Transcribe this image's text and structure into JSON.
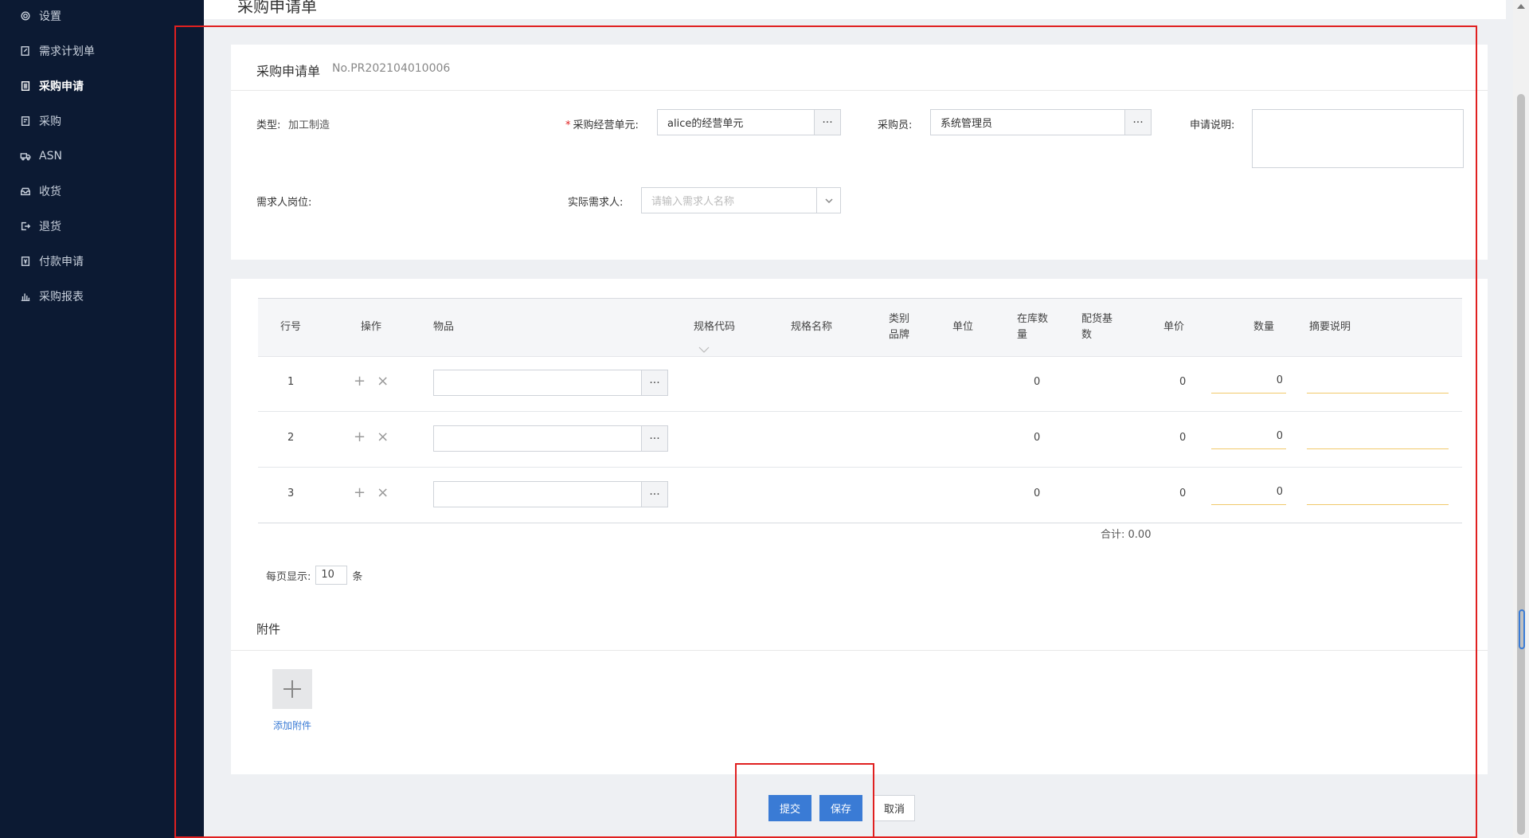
{
  "sidebar": {
    "items": [
      {
        "label": "设置",
        "icon": "gear-icon"
      },
      {
        "label": "需求计划单",
        "icon": "document-edit-icon"
      },
      {
        "label": "采购申请",
        "icon": "document-list-icon"
      },
      {
        "label": "采购",
        "icon": "document-icon"
      },
      {
        "label": "ASN",
        "icon": "truck-icon"
      },
      {
        "label": "收货",
        "icon": "inbox-icon"
      },
      {
        "label": "退货",
        "icon": "exit-icon"
      },
      {
        "label": "付款申请",
        "icon": "payment-icon"
      },
      {
        "label": "采购报表",
        "icon": "bar-chart-icon"
      }
    ],
    "active_index": 2
  },
  "page": {
    "title": "采购申请单"
  },
  "form": {
    "header_title": "采购申请单",
    "number": "No.PR202104010006",
    "type_label": "类型:",
    "type_value": "加工制造",
    "unit_label": "采购经营单元:",
    "unit_required_mark": "*",
    "unit_value": "alice的经营单元",
    "buyer_label": "采购员:",
    "buyer_value": "系统管理员",
    "desc_label": "申请说明:",
    "desc_value": "",
    "post_label": "需求人岗位:",
    "requester_label": "实际需求人:",
    "requester_placeholder": "请输入需求人名称",
    "ellipsis": "···"
  },
  "table": {
    "headers": {
      "line_no": "行号",
      "ops": "操作",
      "item": "物品",
      "spec_code": "规格代码",
      "spec_name": "规格名称",
      "category_1": "类别",
      "category_2": "品牌",
      "unit": "单位",
      "stock_1": "在库数",
      "stock_2": "量",
      "ratio_1": "配货基",
      "ratio_2": "数",
      "price": "单价",
      "qty": "数量",
      "memo": "摘要说明"
    },
    "rows": [
      {
        "line": "1",
        "stock": "0",
        "price": "0",
        "qty": "0",
        "add": "+",
        "remove": "×"
      },
      {
        "line": "2",
        "stock": "0",
        "price": "0",
        "qty": "0",
        "add": "+",
        "remove": "×"
      },
      {
        "line": "3",
        "stock": "0",
        "price": "0",
        "qty": "0",
        "add": "+",
        "remove": "×"
      }
    ],
    "total_label": "合计:",
    "total_value": "0.00"
  },
  "pager": {
    "prefix": "每页显示:",
    "value": "10",
    "suffix": "条"
  },
  "attachments": {
    "title": "附件",
    "add_label": "添加附件"
  },
  "actions": {
    "submit": "提交",
    "save": "保存",
    "cancel": "取消"
  },
  "colors": {
    "sidebar_bg": "#0c1a33",
    "primary": "#3a7bd5",
    "highlight_frame": "#e02020",
    "input_underline": "#f1c96b"
  }
}
